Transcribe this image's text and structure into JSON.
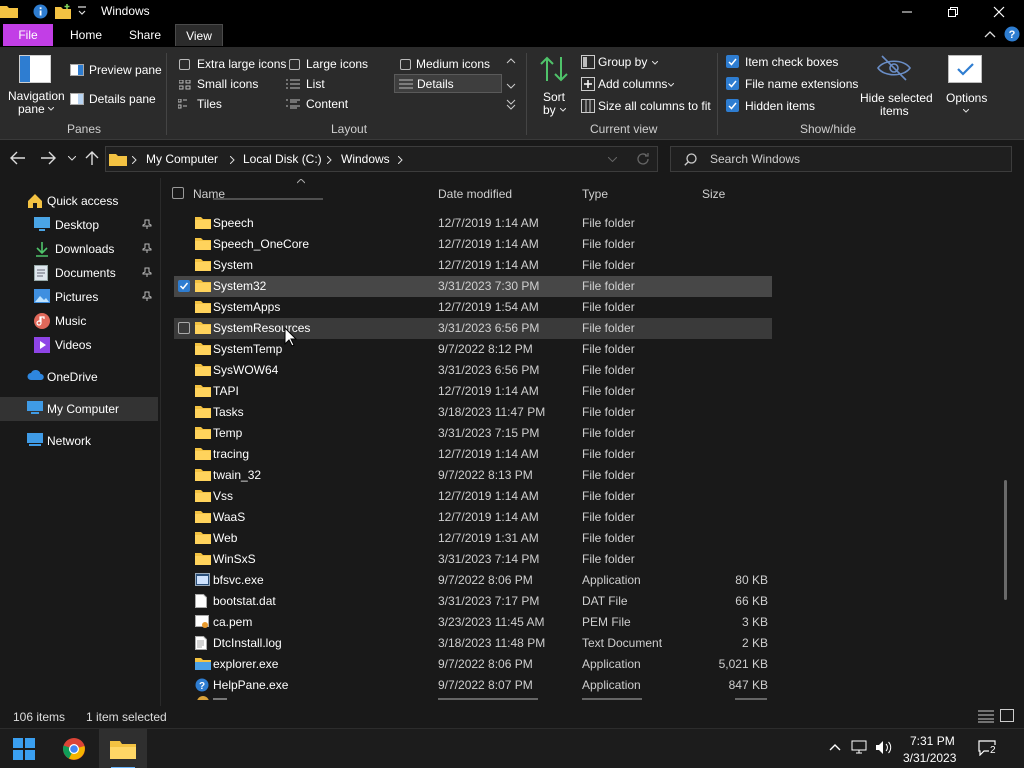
{
  "window": {
    "title": "Windows"
  },
  "tabs": {
    "file": "File",
    "home": "Home",
    "share": "Share",
    "view": "View"
  },
  "ribbon": {
    "panes": {
      "navigation_pane": "Navigation",
      "navigation_pane_2": "pane",
      "preview_pane": "Preview pane",
      "details_pane": "Details pane",
      "group": "Panes"
    },
    "layout": {
      "extra_large": "Extra large icons",
      "large": "Large icons",
      "medium": "Medium icons",
      "small": "Small icons",
      "list": "List",
      "details": "Details",
      "tiles": "Tiles",
      "content": "Content",
      "group": "Layout"
    },
    "current_view": {
      "sort_by": "Sort",
      "sort_by_2": "by",
      "group_by": "Group by",
      "add_columns": "Add columns",
      "size_all": "Size all columns to fit",
      "group": "Current view"
    },
    "show_hide": {
      "item_check_boxes": "Item check boxes",
      "file_name_extensions": "File name extensions",
      "hidden_items": "Hidden items",
      "hide_selected": "Hide selected",
      "hide_selected_2": "items",
      "options": "Options",
      "group": "Show/hide"
    }
  },
  "address": {
    "crumbs": [
      "My Computer",
      "Local Disk (C:)",
      "Windows"
    ],
    "search_placeholder": "Search Windows"
  },
  "sidebar": {
    "items": [
      {
        "label": "Quick access"
      },
      {
        "label": "Desktop"
      },
      {
        "label": "Downloads"
      },
      {
        "label": "Documents"
      },
      {
        "label": "Pictures"
      },
      {
        "label": "Music"
      },
      {
        "label": "Videos"
      },
      {
        "label": "OneDrive"
      },
      {
        "label": "My Computer"
      },
      {
        "label": "Network"
      }
    ]
  },
  "columns": {
    "name": "Name",
    "date": "Date modified",
    "type": "Type",
    "size": "Size"
  },
  "files": [
    {
      "name": "Speech",
      "date": "12/7/2019 1:14 AM",
      "type": "File folder",
      "size": ""
    },
    {
      "name": "Speech_OneCore",
      "date": "12/7/2019 1:14 AM",
      "type": "File folder",
      "size": ""
    },
    {
      "name": "System",
      "date": "12/7/2019 1:14 AM",
      "type": "File folder",
      "size": ""
    },
    {
      "name": "System32",
      "date": "3/31/2023 7:30 PM",
      "type": "File folder",
      "size": ""
    },
    {
      "name": "SystemApps",
      "date": "12/7/2019 1:54 AM",
      "type": "File folder",
      "size": ""
    },
    {
      "name": "SystemResources",
      "date": "3/31/2023 6:56 PM",
      "type": "File folder",
      "size": ""
    },
    {
      "name": "SystemTemp",
      "date": "9/7/2022 8:12 PM",
      "type": "File folder",
      "size": ""
    },
    {
      "name": "SysWOW64",
      "date": "3/31/2023 6:56 PM",
      "type": "File folder",
      "size": ""
    },
    {
      "name": "TAPI",
      "date": "12/7/2019 1:14 AM",
      "type": "File folder",
      "size": ""
    },
    {
      "name": "Tasks",
      "date": "3/18/2023 11:47 PM",
      "type": "File folder",
      "size": ""
    },
    {
      "name": "Temp",
      "date": "3/31/2023 7:15 PM",
      "type": "File folder",
      "size": ""
    },
    {
      "name": "tracing",
      "date": "12/7/2019 1:14 AM",
      "type": "File folder",
      "size": ""
    },
    {
      "name": "twain_32",
      "date": "9/7/2022 8:13 PM",
      "type": "File folder",
      "size": ""
    },
    {
      "name": "Vss",
      "date": "12/7/2019 1:14 AM",
      "type": "File folder",
      "size": ""
    },
    {
      "name": "WaaS",
      "date": "12/7/2019 1:14 AM",
      "type": "File folder",
      "size": ""
    },
    {
      "name": "Web",
      "date": "12/7/2019 1:31 AM",
      "type": "File folder",
      "size": ""
    },
    {
      "name": "WinSxS",
      "date": "3/31/2023 7:14 PM",
      "type": "File folder",
      "size": ""
    },
    {
      "name": "bfsvc.exe",
      "date": "9/7/2022 8:06 PM",
      "type": "Application",
      "size": "80 KB"
    },
    {
      "name": "bootstat.dat",
      "date": "3/31/2023 7:17 PM",
      "type": "DAT File",
      "size": "66 KB"
    },
    {
      "name": "ca.pem",
      "date": "3/23/2023 11:45 AM",
      "type": "PEM File",
      "size": "3 KB"
    },
    {
      "name": "DtcInstall.log",
      "date": "3/18/2023 11:48 PM",
      "type": "Text Document",
      "size": "2 KB"
    },
    {
      "name": "explorer.exe",
      "date": "9/7/2022 8:06 PM",
      "type": "Application",
      "size": "5,021 KB"
    },
    {
      "name": "HelpPane.exe",
      "date": "9/7/2022 8:07 PM",
      "type": "Application",
      "size": "847 KB"
    }
  ],
  "status": {
    "count": "106 items",
    "selected": "1 item selected"
  },
  "taskbar": {
    "time": "7:31 PM",
    "date": "3/31/2023",
    "notifications": "2"
  },
  "colors": {
    "accent": "#2e7dd1",
    "file_tab": "#c23ee6",
    "folder": "#f3c242"
  }
}
